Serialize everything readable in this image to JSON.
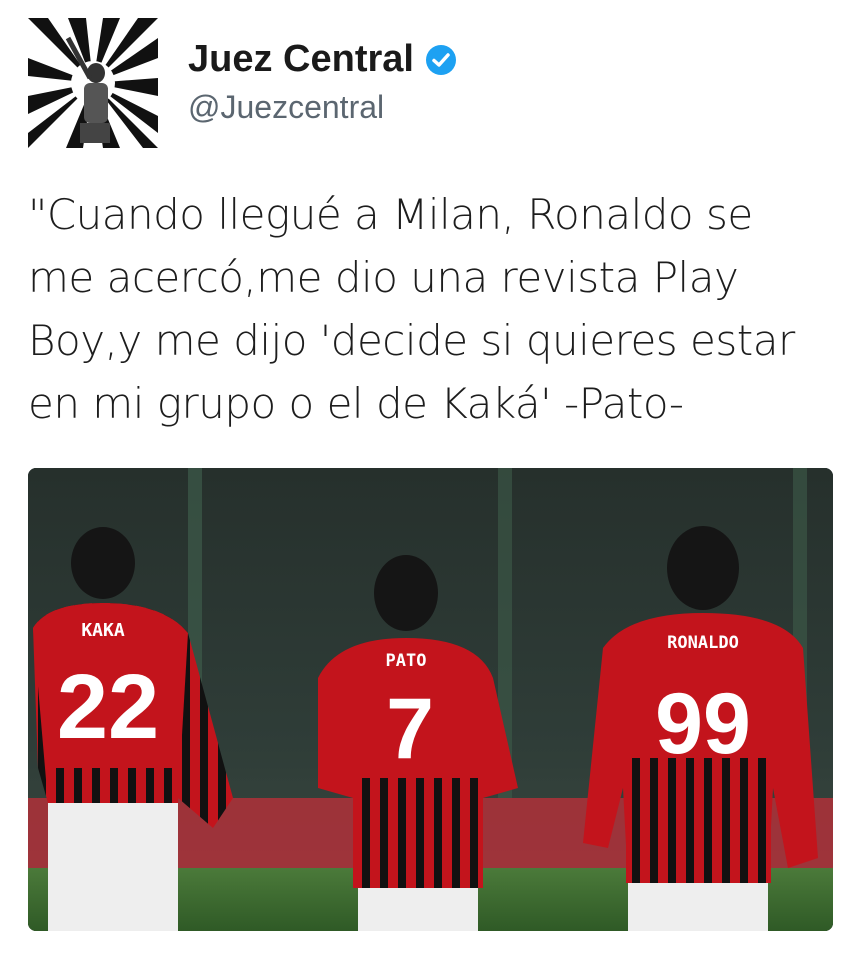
{
  "author": {
    "name": "Juez Central",
    "handle": "@Juezcentral",
    "verified": true
  },
  "tweet": {
    "lines": [
      "\"Cuando llegué a Milan, Ronaldo se",
      "me acercó,me dio una revista Play",
      "Boy,y me dijo 'decide si quieres estar",
      "en mi grupo o el de Kaká' -Pato-"
    ]
  },
  "photo": {
    "players": [
      {
        "shirt_name": "KAKA",
        "number": "22"
      },
      {
        "shirt_name": "PATO",
        "number": "7"
      },
      {
        "shirt_name": "RONALDO",
        "number": "99"
      }
    ]
  },
  "colors": {
    "verified_badge": "#1da1f2",
    "jersey_red": "#c3141c",
    "jersey_black": "#111111"
  }
}
